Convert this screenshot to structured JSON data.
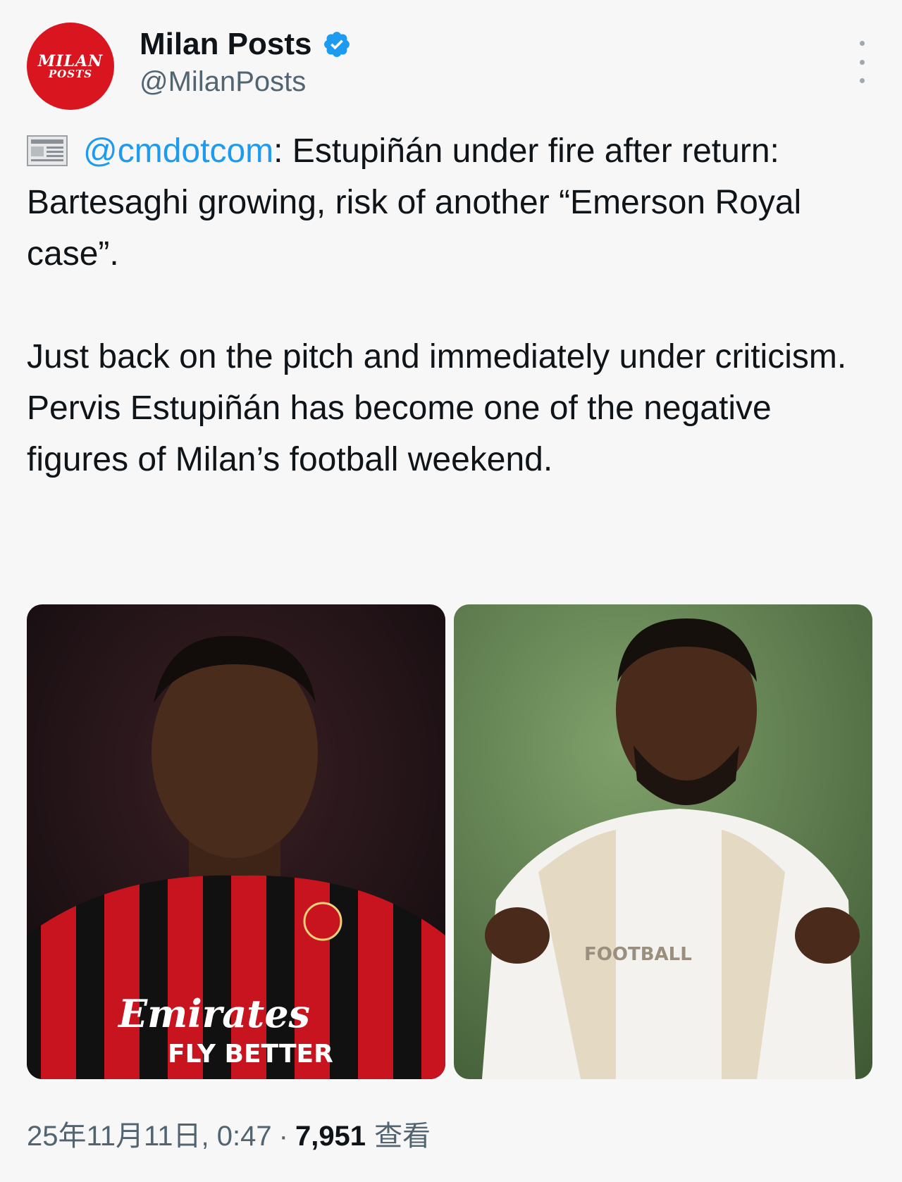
{
  "author": {
    "avatar_line1": "MILAN",
    "avatar_line2": "POSTS",
    "display_name": "Milan Posts",
    "handle": "@MilanPosts",
    "verified": true
  },
  "tweet": {
    "news_icon": "newspaper-icon",
    "mention": "@cmdotcom",
    "headline_rest": ": Estupiñán under fire after return: Bartesaghi growing, risk of another “Emerson Royal case”.",
    "paragraph2": "Just back on the pitch and immediately under criticism. Pervis Estupiñán has become one of the negative figures of Milan’s football weekend."
  },
  "media": {
    "photo1_shirt_line1": "Emirates",
    "photo1_shirt_line2": "FLY BETTER",
    "photo2_shirt_text": "FOOTBALL"
  },
  "meta": {
    "date_time": "25年11月11日, 0:47",
    "separator": "·",
    "views_count": "7,951",
    "views_label": "查看"
  },
  "colors": {
    "accent": "#1d9bf0",
    "avatar_bg": "#d9151f",
    "text_primary": "#0f1419",
    "text_secondary": "#536471"
  }
}
